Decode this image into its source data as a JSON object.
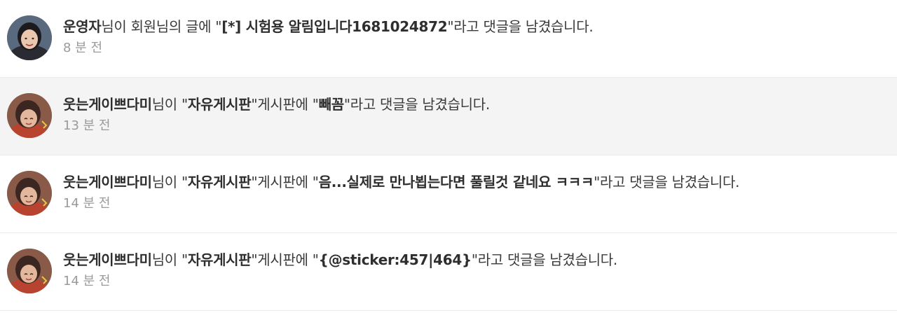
{
  "notifications": [
    {
      "actor": "운영자",
      "seg1": "님이 회원님의 글에 \"",
      "target": "[*] 시험용 알림입니다1681024872",
      "seg2": "\"라고 댓글을 남겼습니다.",
      "time": "8 분 전",
      "avatar_icon": "profile-photo"
    },
    {
      "actor": "웃는게이쁘다미",
      "seg1": "님이 \"",
      "board": "자유게시판",
      "seg2": "\"게시판에 \"",
      "comment": "빼꼼",
      "seg3": "\"라고 댓글을 남겼습니다.",
      "time": "13 분 전",
      "avatar_icon": "profile-photo"
    },
    {
      "actor": "웃는게이쁘다미",
      "seg1": "님이 \"",
      "board": "자유게시판",
      "seg2": "\"게시판에 \"",
      "comment": "음...실제로 만나뵙는다면 풀릴것 같네요 ㅋㅋㅋ",
      "seg3": "\"라고 댓글을 남겼습니다.",
      "time": "14 분 전",
      "avatar_icon": "profile-photo"
    },
    {
      "actor": "웃는게이쁘다미",
      "seg1": "님이 \"",
      "board": "자유게시판",
      "seg2": "\"게시판에 \"",
      "comment": "{@sticker:457|464}",
      "seg3": "\"라고 댓글을 남겼습니다.",
      "time": "14 분 전",
      "avatar_icon": "profile-photo"
    }
  ]
}
